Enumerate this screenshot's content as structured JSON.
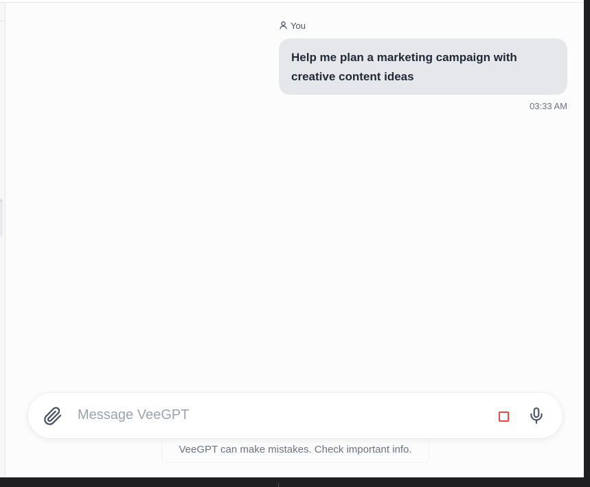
{
  "chat": {
    "sender_label": "You",
    "sender_icon": "user-icon",
    "message_text": "Help me plan a marketing campaign with creative content ideas",
    "timestamp": "03:33 AM"
  },
  "composer": {
    "placeholder": "Message VeeGPT",
    "value": "",
    "attach_icon": "paperclip-icon",
    "stop_icon": "stop-icon",
    "mic_icon": "microphone-icon"
  },
  "footer": {
    "disclaimer": "VeeGPT can make mistakes. Check important info."
  },
  "colors": {
    "bubble_bg": "#e5e7eb",
    "stop_accent": "#ef4444",
    "background": "#fcfcfd"
  }
}
